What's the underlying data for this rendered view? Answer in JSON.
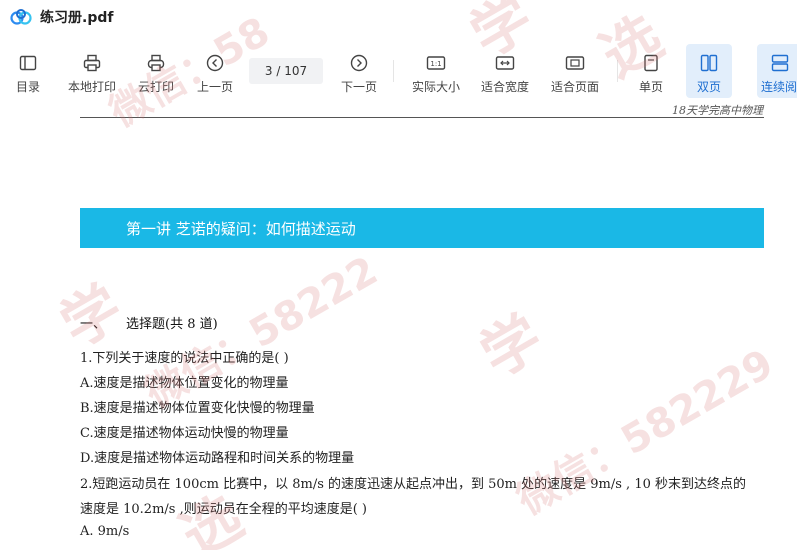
{
  "window": {
    "file_title": "练习册.pdf"
  },
  "toolbar": {
    "toc": "目录",
    "local_print": "本地打印",
    "cloud_print": "云打印",
    "prev_page": "上一页",
    "page_indicator": "3  / 107",
    "next_page": "下一页",
    "actual_size": "实际大小",
    "fit_width": "适合宽度",
    "fit_page": "适合页面",
    "single_page": "单页",
    "double_page": "双页",
    "continuous": "连续阅"
  },
  "document": {
    "header_note": "18天学完高中物理",
    "lecture_title": "第一讲    芝诺的疑问：如何描述运动",
    "section_number": "一、",
    "section_title": "选择题(共 8 道)",
    "lines": [
      "1.下列关于速度的说法中正确的是(     )",
      "A.速度是描述物体位置变化的物理量",
      "B.速度是描述物体位置变化快慢的物理量",
      "C.速度是描述物体运动快慢的物理量",
      "D.速度是描述物体运动路程和时间关系的物理量",
      "2.短跑运动员在 100cm 比赛中，以 8m/s 的速度迅速从起点冲出，到 50m 处的速度是 9m/s , 10 秒末到达终点的",
      "速度是 10.2m/s ,则运动员在全程的平均速度是(     )",
      "A. 9m/s"
    ]
  },
  "watermarks": [
    "学",
    "选",
    "微信：58",
    "学",
    "微信：58222",
    "学",
    "选",
    "微信：582229"
  ]
}
